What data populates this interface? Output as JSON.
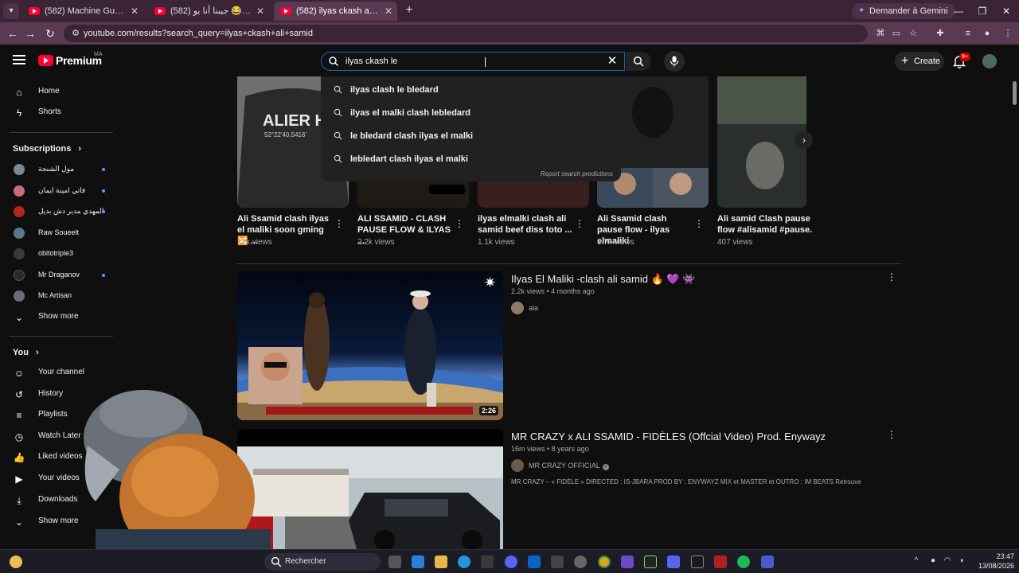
{
  "browser": {
    "tabs": [
      {
        "title": "(582) Machine Gun Kelly \"Rap D",
        "active": false
      },
      {
        "title": "(582) بكاء هستيري 😂 جيبنا أنا يو",
        "active": false
      },
      {
        "title": "(582) ilyas ckash ali samid - You",
        "active": true
      }
    ],
    "gemini_label": "Demander à Gemini",
    "url": "youtube.com/results?search_query=ilyas+ckash+ali+samid"
  },
  "masthead": {
    "logo_text": "Premium",
    "region": "MA",
    "search_value": "ilyas ckash le",
    "create_label": "Create",
    "notification_count": "9+"
  },
  "suggestions": {
    "items": [
      "ilyas clash le bledard",
      "ilyas el malki clash lebledard",
      "le bledard clash ilyas el malki",
      "lebledart clash ilyas el malki"
    ],
    "report": "Report search predictions"
  },
  "sidebar": {
    "main": [
      {
        "label": "Home",
        "icon": "home-icon"
      },
      {
        "label": "Shorts",
        "icon": "shorts-icon"
      }
    ],
    "subscriptions_header": "Subscriptions",
    "channels": [
      {
        "name": "مول الشنجة",
        "color": "#7b8794",
        "dot": true
      },
      {
        "name": "فاتي امينة ايمان",
        "color": "#c86b7c",
        "dot": true
      },
      {
        "name": "المهدي مدير دش بديل",
        "color": "#b3261e",
        "dot": true
      },
      {
        "name": "Raw Soueelt",
        "color": "#5a7a8c",
        "dot": false
      },
      {
        "name": "obitotriple3",
        "color": "#3a3a3a",
        "dot": false
      },
      {
        "name": "Mr Draganov",
        "color": "#2a2a2a",
        "dot": true
      },
      {
        "name": "Mc Artisan",
        "color": "#6d6d7a",
        "dot": false
      }
    ],
    "show_more": "Show more",
    "you_header": "You",
    "you_items": [
      {
        "label": "Your channel",
        "icon": "channel-icon"
      },
      {
        "label": "History",
        "icon": "history-icon"
      },
      {
        "label": "Playlists",
        "icon": "playlists-icon"
      },
      {
        "label": "Watch Later",
        "icon": "watch-later-icon"
      },
      {
        "label": "Liked videos",
        "icon": "like-icon"
      },
      {
        "label": "Your videos",
        "icon": "your-videos-icon"
      },
      {
        "label": "Downloads",
        "icon": "download-icon"
      },
      {
        "label": "Show more",
        "icon": "chevron-down-icon"
      }
    ]
  },
  "shorts": [
    {
      "title": "Ali Ssamid clash ilyas el maliki soon gming 🔀 ...",
      "views": "12k views",
      "thumb_color": "#2b2b2b"
    },
    {
      "title": "ALI SSAMID - CLASH PAUSE FLOW & ILYAS ...",
      "views": "2.2k views",
      "thumb_color": "#3b3026"
    },
    {
      "title": "ilyas elmalki clash ali samid beef diss toto ...",
      "views": "1.1k views",
      "thumb_color": "#262626"
    },
    {
      "title": "Ali Ssamid clash pause flow - ilyas elmaliki",
      "views": "9.7k views",
      "thumb_color": "#1f2a33"
    },
    {
      "title": "Ali samid Clash pause flow #alisamid #pause.",
      "views": "407 views",
      "thumb_color": "#384038"
    }
  ],
  "results": [
    {
      "title": "Ilyas El Maliki -clash ali samid 🔥 💜 👾",
      "meta": "2.2k views • 4 months ago",
      "channel": "ala",
      "verified": false,
      "description": "",
      "duration": "2:26"
    },
    {
      "title": "MR CRAZY x ALI SSAMID - FIDÈLES (Offcial Video) Prod. Enywayz",
      "meta": "16m views • 8 years ago",
      "channel": "MR CRAZY OFFICIAL",
      "verified": true,
      "description": "MR CRAZY – « FIDÈLE » DIRECTED : IS-JBARA PROD BY : ENYWAYZ MIX et MASTER et OUTRO : IM BEATS Retrouvez MR ...",
      "duration": ""
    }
  ],
  "taskbar": {
    "search_label": "Rechercher",
    "time": "23:47",
    "date": "13/08/2026"
  },
  "colors": {
    "brand": "#ff0033",
    "background": "#0f0f0f",
    "browser_frame": "#5a3952"
  }
}
